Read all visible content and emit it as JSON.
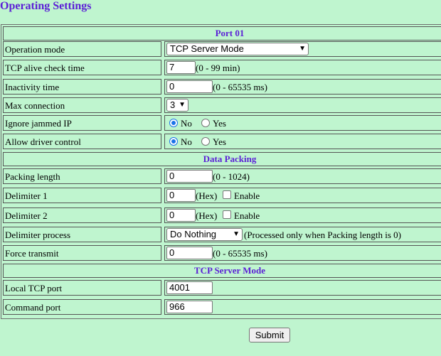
{
  "page_title": "Operating Settings",
  "sections": {
    "port": "Port 01",
    "packing": "Data Packing",
    "mode": "TCP Server Mode"
  },
  "fields": {
    "operation_mode": {
      "label": "Operation mode",
      "value": "TCP Server Mode"
    },
    "tcp_alive": {
      "label": "TCP alive check time",
      "value": "7",
      "note": "(0 - 99 min)"
    },
    "inactivity": {
      "label": "Inactivity time",
      "value": "0",
      "note": "(0 - 65535 ms)"
    },
    "max_conn": {
      "label": "Max connection",
      "value": "3"
    },
    "ignore_ip": {
      "label": "Ignore jammed IP",
      "opt_no": "No",
      "opt_yes": "Yes",
      "selected": "No"
    },
    "driver_ctrl": {
      "label": "Allow driver control",
      "opt_no": "No",
      "opt_yes": "Yes",
      "selected": "No"
    },
    "pack_len": {
      "label": "Packing length",
      "value": "0",
      "note": "(0 - 1024)"
    },
    "delim1": {
      "label": "Delimiter 1",
      "value": "0",
      "note": "(Hex)",
      "enable": "Enable",
      "enabled": false
    },
    "delim2": {
      "label": "Delimiter 2",
      "value": "0",
      "note": "(Hex)",
      "enable": "Enable",
      "enabled": false
    },
    "delim_proc": {
      "label": "Delimiter process",
      "value": "Do Nothing",
      "note": "(Processed only when Packing length is 0)"
    },
    "force_tx": {
      "label": "Force transmit",
      "value": "0",
      "note": "(0 - 65535 ms)"
    },
    "local_port": {
      "label": "Local TCP port",
      "value": "4001"
    },
    "cmd_port": {
      "label": "Command port",
      "value": "966"
    }
  },
  "submit_label": "Submit",
  "icons": {
    "dropdown": "chevron-down-icon"
  }
}
